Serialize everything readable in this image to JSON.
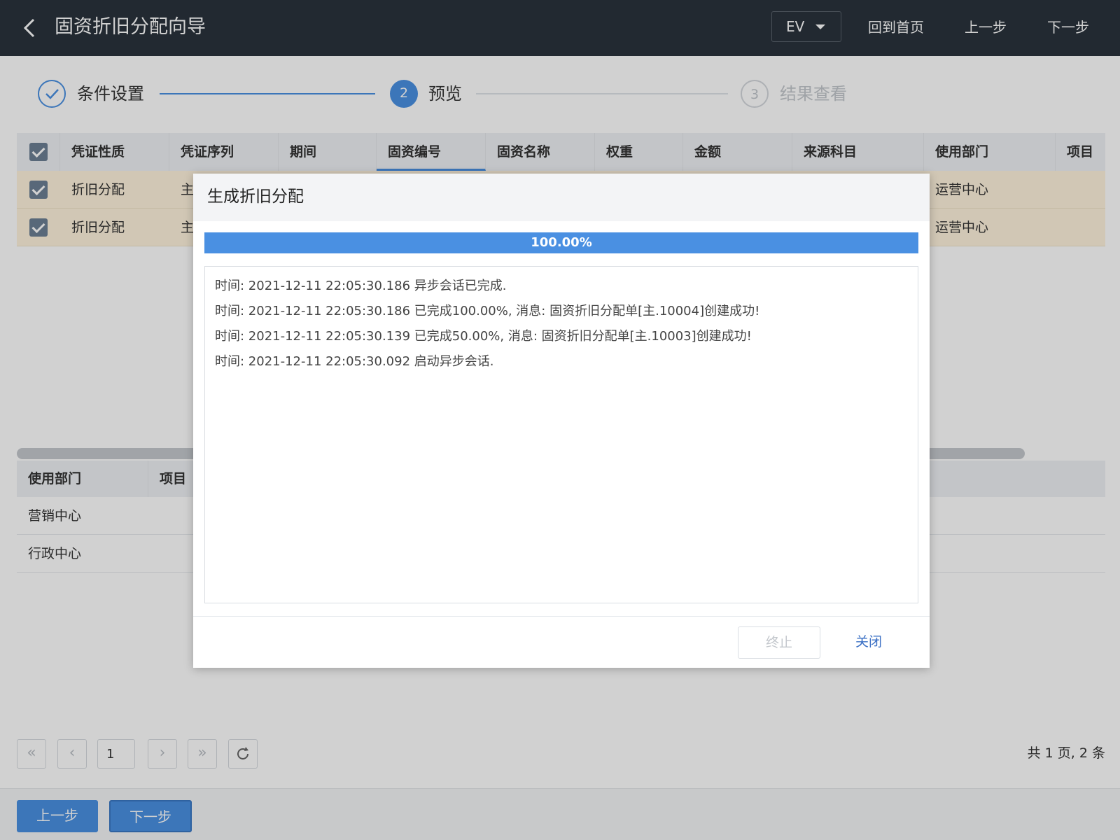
{
  "header": {
    "title": "固资折旧分配向导",
    "env": "EV",
    "home": "回到首页",
    "prev": "上一步",
    "next": "下一步"
  },
  "steps": [
    {
      "num": "",
      "label": "条件设置",
      "state": "done"
    },
    {
      "num": "2",
      "label": "预览",
      "state": "active"
    },
    {
      "num": "3",
      "label": "结果查看",
      "state": "pending"
    }
  ],
  "grid": {
    "columns": [
      "凭证性质",
      "凭证序列",
      "期间",
      "固资编号",
      "固资名称",
      "权重",
      "金额",
      "来源科目",
      "使用部门",
      "项目"
    ],
    "rows": [
      {
        "type": "折旧分配",
        "serial": "主",
        "dept": "运营中心"
      },
      {
        "type": "折旧分配",
        "serial": "主",
        "dept": "运营中心"
      }
    ]
  },
  "sub_table": {
    "columns": [
      "使用部门",
      "项目"
    ],
    "rows": [
      "营销中心",
      "行政中心"
    ]
  },
  "pagination": {
    "first": "«",
    "prev": "‹",
    "page": "1",
    "next": "›",
    "last": "»",
    "total": "共 1 页, 2 条"
  },
  "footer": {
    "prev": "上一步",
    "next": "下一步"
  },
  "dialog": {
    "title": "生成折旧分配",
    "progress_text": "100.00%",
    "progress_value": 100,
    "log": [
      "时间: 2021-12-11 22:05:30.186 异步会话已完成.",
      "时间: 2021-12-11 22:05:30.186 已完成100.00%, 消息: 固资折旧分配单[主.10004]创建成功!",
      "时间: 2021-12-11 22:05:30.139 已完成50.00%, 消息: 固资折旧分配单[主.10003]创建成功!",
      "时间: 2021-12-11 22:05:30.092 启动异步会话."
    ],
    "stop": "终止",
    "close": "关闭"
  },
  "colors": {
    "header_bg": "#2a323c",
    "accent": "#4a90e2",
    "row_highlight": "#fff3dd"
  }
}
